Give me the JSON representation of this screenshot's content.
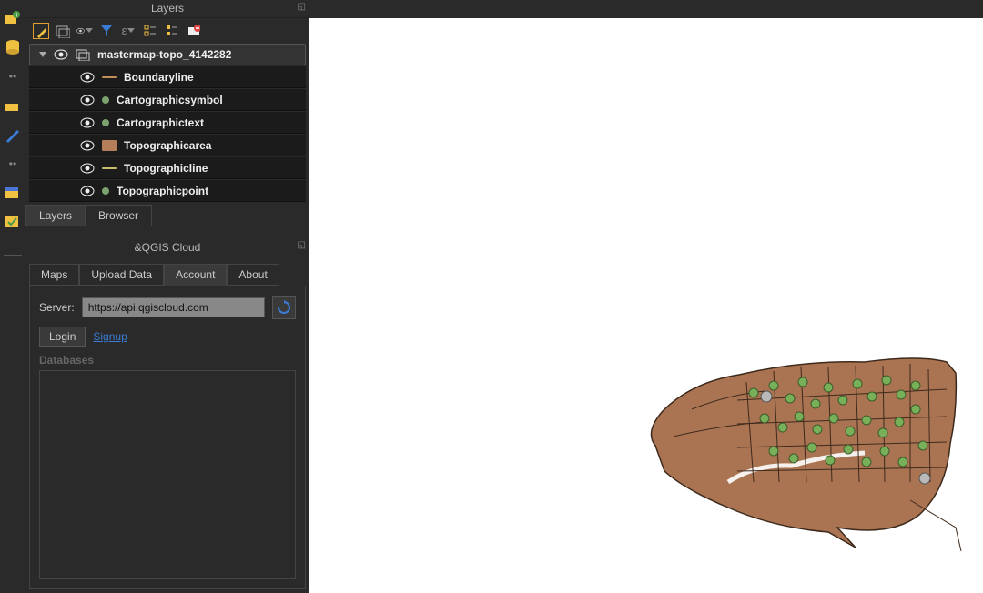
{
  "layers_panel": {
    "title": "Layers",
    "group": "mastermap-topo_4142282",
    "items": [
      {
        "label": "Boundaryline",
        "type": "line",
        "color": "#c28e5c"
      },
      {
        "label": "Cartographicsymbol",
        "type": "point",
        "color": "#7aa26f"
      },
      {
        "label": "Cartographictext",
        "type": "point",
        "color": "#7aa26f"
      },
      {
        "label": "Topographicarea",
        "type": "fill",
        "color": "#b57e5b"
      },
      {
        "label": "Topographicline",
        "type": "line",
        "color": "#c9c06c"
      },
      {
        "label": "Topographicpoint",
        "type": "point",
        "color": "#7aa26f"
      }
    ],
    "bottom_tabs": {
      "layers": "Layers",
      "browser": "Browser",
      "active": "layers"
    }
  },
  "cloud_panel": {
    "title": "&QGIS Cloud",
    "tabs": {
      "maps": "Maps",
      "upload": "Upload Data",
      "account": "Account",
      "about": "About",
      "active": "account"
    },
    "server_label": "Server:",
    "server_value": "https://api.qgiscloud.com",
    "login": "Login",
    "signup": "Signup",
    "databases": "Databases"
  },
  "colors": {
    "brown": "#aa7452",
    "green": "#78b05a",
    "darkline": "#3d2a1c"
  }
}
